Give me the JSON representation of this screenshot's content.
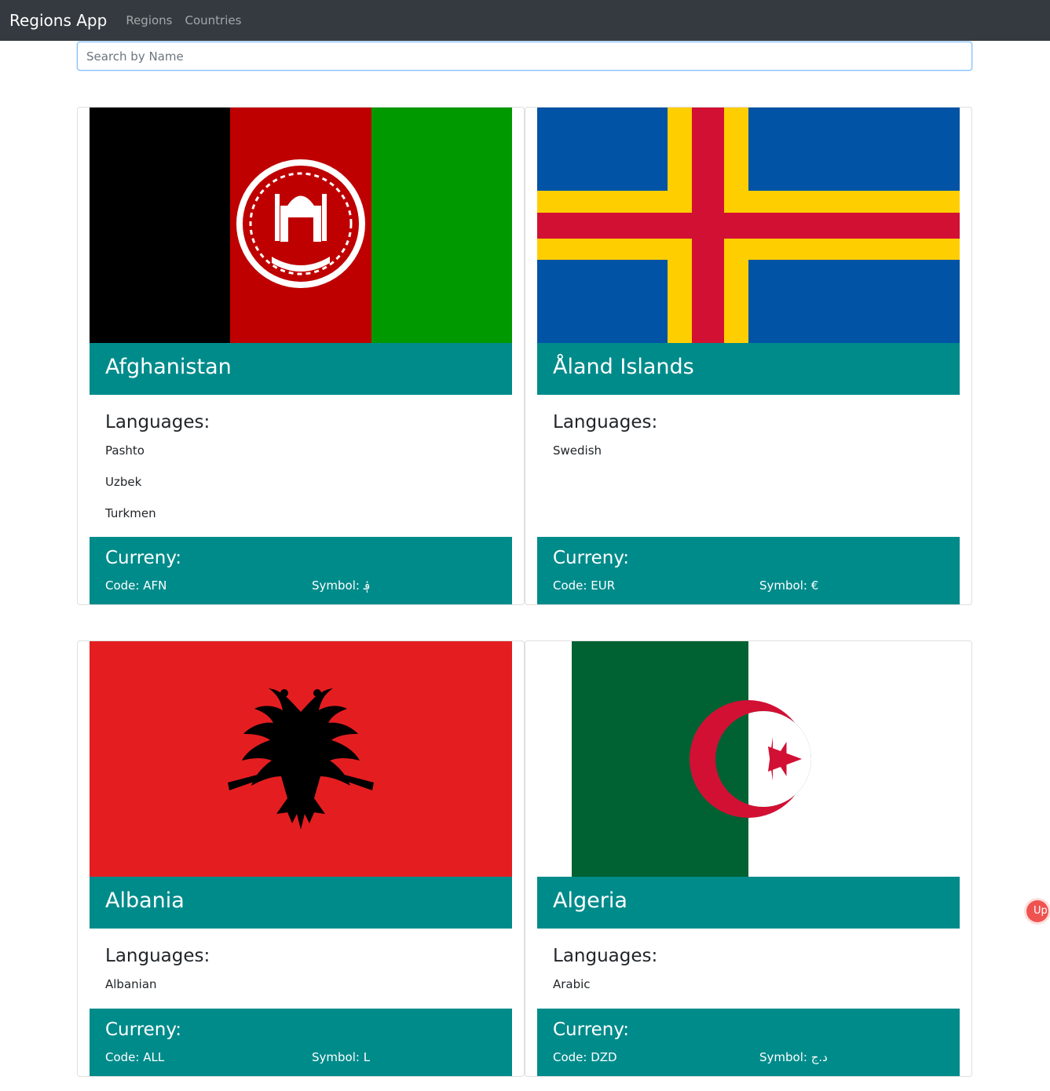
{
  "navbar": {
    "brand": "Regions App",
    "links": [
      "Regions",
      "Countries"
    ]
  },
  "search": {
    "placeholder": "Search by Name",
    "value": ""
  },
  "labels": {
    "languages": "Languages:",
    "currency": "Curreny:",
    "code_prefix": "Code: ",
    "symbol_prefix": "Symbol: "
  },
  "countries": [
    {
      "name": "Afghanistan",
      "languages": [
        "Pashto",
        "Uzbek",
        "Turkmen"
      ],
      "currency": {
        "code": "AFN",
        "symbol": "؋"
      }
    },
    {
      "name": "Åland Islands",
      "languages": [
        "Swedish"
      ],
      "currency": {
        "code": "EUR",
        "symbol": "€"
      }
    },
    {
      "name": "Albania",
      "languages": [
        "Albanian"
      ],
      "currency": {
        "code": "ALL",
        "symbol": "L"
      }
    },
    {
      "name": "Algeria",
      "languages": [
        "Arabic"
      ],
      "currency": {
        "code": "DZD",
        "symbol": "د.ج"
      }
    }
  ],
  "side_badge": {
    "text": "Up"
  },
  "colors": {
    "navbar": "#343a40",
    "accent": "#008b8b"
  }
}
